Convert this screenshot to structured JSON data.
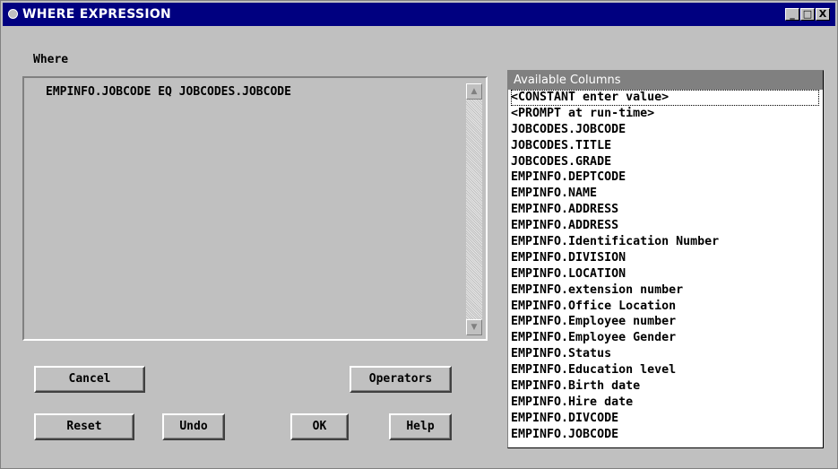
{
  "window": {
    "title": "WHERE EXPRESSION",
    "controls": {
      "minimize": "_",
      "maximize": "□",
      "close": "X"
    }
  },
  "where": {
    "label": "Where",
    "expression": "EMPINFO.JOBCODE EQ JOBCODES.JOBCODE"
  },
  "buttons": {
    "cancel": "Cancel",
    "operators": "Operators",
    "reset": "Reset",
    "undo": "Undo",
    "ok": "OK",
    "help": "Help"
  },
  "available": {
    "header": "Available Columns",
    "items": [
      "<CONSTANT enter value>",
      "<PROMPT at run-time>",
      "JOBCODES.JOBCODE",
      "JOBCODES.TITLE",
      "JOBCODES.GRADE",
      "EMPINFO.DEPTCODE",
      "EMPINFO.NAME",
      "EMPINFO.ADDRESS",
      "EMPINFO.ADDRESS",
      "EMPINFO.Identification Number",
      "EMPINFO.DIVISION",
      "EMPINFO.LOCATION",
      "EMPINFO.extension number",
      "EMPINFO.Office Location",
      "EMPINFO.Employee number",
      "EMPINFO.Employee Gender",
      "EMPINFO.Status",
      "EMPINFO.Education level",
      "EMPINFO.Birth date",
      "EMPINFO.Hire date",
      "EMPINFO.DIVCODE",
      "EMPINFO.JOBCODE"
    ]
  },
  "colors": {
    "titlebar": "#000080",
    "face": "#c0c0c0",
    "header": "#808080"
  }
}
